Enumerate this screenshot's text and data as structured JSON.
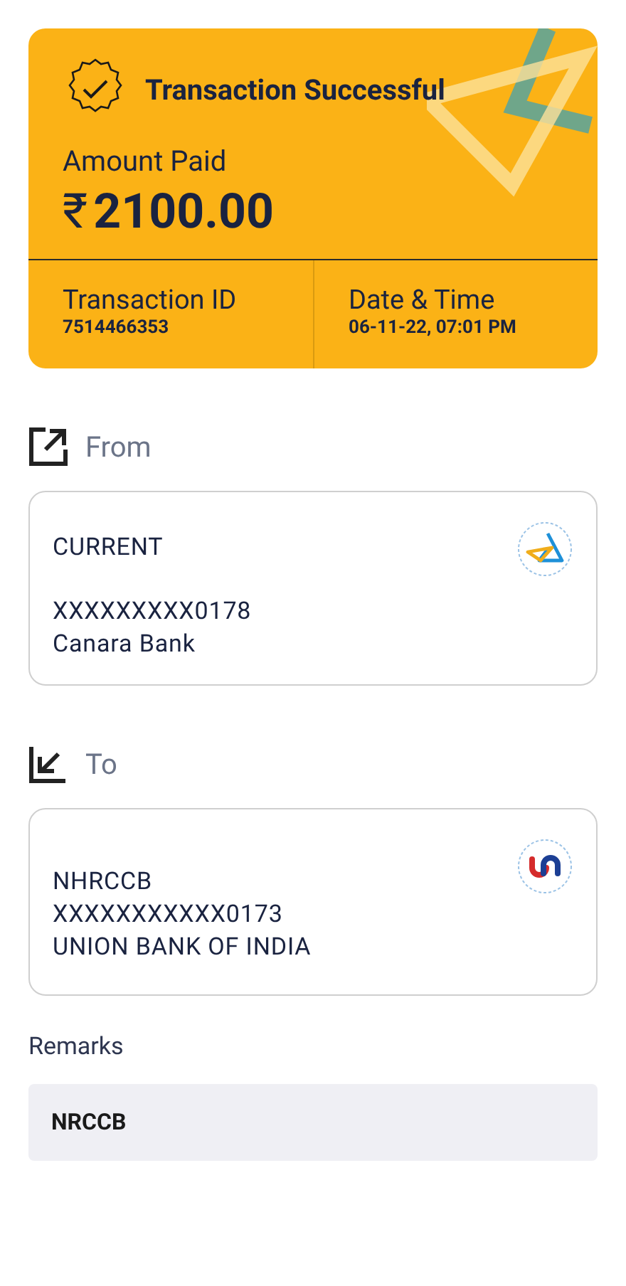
{
  "status": {
    "title": "Transaction Successful",
    "amount_label": "Amount Paid",
    "currency": "₹",
    "amount": "2100.00",
    "details": [
      {
        "label": "Transaction ID",
        "value": "7514466353"
      },
      {
        "label": "Date & Time",
        "value": "06-11-22, 07:01 PM"
      }
    ]
  },
  "parties": [
    {
      "kind": "outgoing",
      "heading": "From",
      "logo": {
        "kind": "triangle"
      },
      "account_type": "CURRENT",
      "lines": [
        "XXXXXXXXX0178",
        "Canara Bank"
      ]
    },
    {
      "kind": "incoming",
      "heading": "To",
      "logo": {
        "kind": "u_shape"
      },
      "lines": [
        "NHRCCB",
        "XXXXXXXXXXX0173",
        "UNION BANK OF INDIA"
      ]
    }
  ],
  "remarks": {
    "label": "Remarks",
    "value": "NRCCB"
  }
}
